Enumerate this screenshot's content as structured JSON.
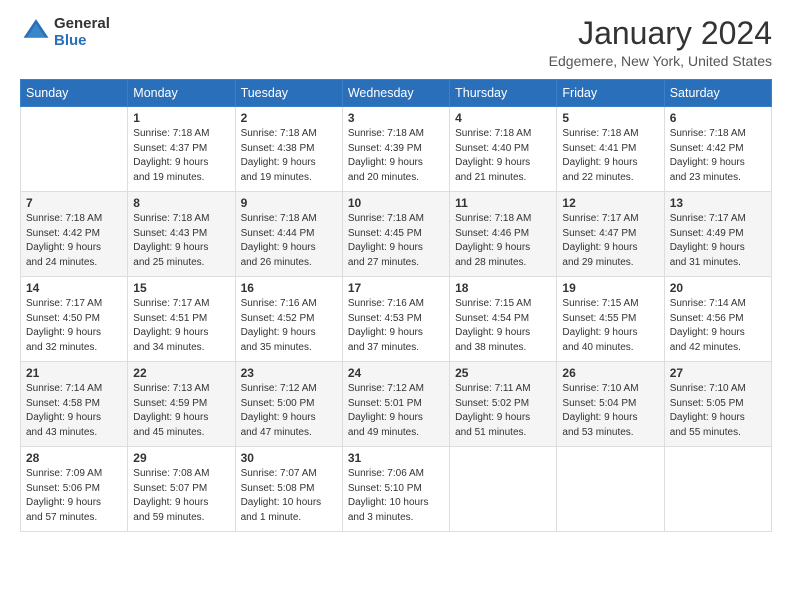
{
  "logo": {
    "line1": "General",
    "line2": "Blue"
  },
  "title": "January 2024",
  "location": "Edgemere, New York, United States",
  "weekdays": [
    "Sunday",
    "Monday",
    "Tuesday",
    "Wednesday",
    "Thursday",
    "Friday",
    "Saturday"
  ],
  "weeks": [
    [
      {
        "day": "",
        "content": ""
      },
      {
        "day": "1",
        "content": "Sunrise: 7:18 AM\nSunset: 4:37 PM\nDaylight: 9 hours\nand 19 minutes."
      },
      {
        "day": "2",
        "content": "Sunrise: 7:18 AM\nSunset: 4:38 PM\nDaylight: 9 hours\nand 19 minutes."
      },
      {
        "day": "3",
        "content": "Sunrise: 7:18 AM\nSunset: 4:39 PM\nDaylight: 9 hours\nand 20 minutes."
      },
      {
        "day": "4",
        "content": "Sunrise: 7:18 AM\nSunset: 4:40 PM\nDaylight: 9 hours\nand 21 minutes."
      },
      {
        "day": "5",
        "content": "Sunrise: 7:18 AM\nSunset: 4:41 PM\nDaylight: 9 hours\nand 22 minutes."
      },
      {
        "day": "6",
        "content": "Sunrise: 7:18 AM\nSunset: 4:42 PM\nDaylight: 9 hours\nand 23 minutes."
      }
    ],
    [
      {
        "day": "7",
        "content": "Sunrise: 7:18 AM\nSunset: 4:42 PM\nDaylight: 9 hours\nand 24 minutes."
      },
      {
        "day": "8",
        "content": "Sunrise: 7:18 AM\nSunset: 4:43 PM\nDaylight: 9 hours\nand 25 minutes."
      },
      {
        "day": "9",
        "content": "Sunrise: 7:18 AM\nSunset: 4:44 PM\nDaylight: 9 hours\nand 26 minutes."
      },
      {
        "day": "10",
        "content": "Sunrise: 7:18 AM\nSunset: 4:45 PM\nDaylight: 9 hours\nand 27 minutes."
      },
      {
        "day": "11",
        "content": "Sunrise: 7:18 AM\nSunset: 4:46 PM\nDaylight: 9 hours\nand 28 minutes."
      },
      {
        "day": "12",
        "content": "Sunrise: 7:17 AM\nSunset: 4:47 PM\nDaylight: 9 hours\nand 29 minutes."
      },
      {
        "day": "13",
        "content": "Sunrise: 7:17 AM\nSunset: 4:49 PM\nDaylight: 9 hours\nand 31 minutes."
      }
    ],
    [
      {
        "day": "14",
        "content": "Sunrise: 7:17 AM\nSunset: 4:50 PM\nDaylight: 9 hours\nand 32 minutes."
      },
      {
        "day": "15",
        "content": "Sunrise: 7:17 AM\nSunset: 4:51 PM\nDaylight: 9 hours\nand 34 minutes."
      },
      {
        "day": "16",
        "content": "Sunrise: 7:16 AM\nSunset: 4:52 PM\nDaylight: 9 hours\nand 35 minutes."
      },
      {
        "day": "17",
        "content": "Sunrise: 7:16 AM\nSunset: 4:53 PM\nDaylight: 9 hours\nand 37 minutes."
      },
      {
        "day": "18",
        "content": "Sunrise: 7:15 AM\nSunset: 4:54 PM\nDaylight: 9 hours\nand 38 minutes."
      },
      {
        "day": "19",
        "content": "Sunrise: 7:15 AM\nSunset: 4:55 PM\nDaylight: 9 hours\nand 40 minutes."
      },
      {
        "day": "20",
        "content": "Sunrise: 7:14 AM\nSunset: 4:56 PM\nDaylight: 9 hours\nand 42 minutes."
      }
    ],
    [
      {
        "day": "21",
        "content": "Sunrise: 7:14 AM\nSunset: 4:58 PM\nDaylight: 9 hours\nand 43 minutes."
      },
      {
        "day": "22",
        "content": "Sunrise: 7:13 AM\nSunset: 4:59 PM\nDaylight: 9 hours\nand 45 minutes."
      },
      {
        "day": "23",
        "content": "Sunrise: 7:12 AM\nSunset: 5:00 PM\nDaylight: 9 hours\nand 47 minutes."
      },
      {
        "day": "24",
        "content": "Sunrise: 7:12 AM\nSunset: 5:01 PM\nDaylight: 9 hours\nand 49 minutes."
      },
      {
        "day": "25",
        "content": "Sunrise: 7:11 AM\nSunset: 5:02 PM\nDaylight: 9 hours\nand 51 minutes."
      },
      {
        "day": "26",
        "content": "Sunrise: 7:10 AM\nSunset: 5:04 PM\nDaylight: 9 hours\nand 53 minutes."
      },
      {
        "day": "27",
        "content": "Sunrise: 7:10 AM\nSunset: 5:05 PM\nDaylight: 9 hours\nand 55 minutes."
      }
    ],
    [
      {
        "day": "28",
        "content": "Sunrise: 7:09 AM\nSunset: 5:06 PM\nDaylight: 9 hours\nand 57 minutes."
      },
      {
        "day": "29",
        "content": "Sunrise: 7:08 AM\nSunset: 5:07 PM\nDaylight: 9 hours\nand 59 minutes."
      },
      {
        "day": "30",
        "content": "Sunrise: 7:07 AM\nSunset: 5:08 PM\nDaylight: 10 hours\nand 1 minute."
      },
      {
        "day": "31",
        "content": "Sunrise: 7:06 AM\nSunset: 5:10 PM\nDaylight: 10 hours\nand 3 minutes."
      },
      {
        "day": "",
        "content": ""
      },
      {
        "day": "",
        "content": ""
      },
      {
        "day": "",
        "content": ""
      }
    ]
  ]
}
